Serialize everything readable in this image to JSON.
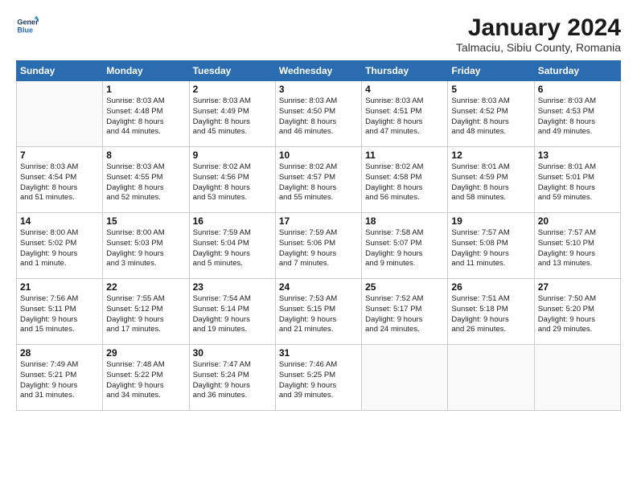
{
  "logo": {
    "line1": "General",
    "line2": "Blue"
  },
  "title": "January 2024",
  "subtitle": "Talmaciu, Sibiu County, Romania",
  "header_days": [
    "Sunday",
    "Monday",
    "Tuesday",
    "Wednesday",
    "Thursday",
    "Friday",
    "Saturday"
  ],
  "weeks": [
    [
      {
        "day": "",
        "text": ""
      },
      {
        "day": "1",
        "text": "Sunrise: 8:03 AM\nSunset: 4:48 PM\nDaylight: 8 hours\nand 44 minutes."
      },
      {
        "day": "2",
        "text": "Sunrise: 8:03 AM\nSunset: 4:49 PM\nDaylight: 8 hours\nand 45 minutes."
      },
      {
        "day": "3",
        "text": "Sunrise: 8:03 AM\nSunset: 4:50 PM\nDaylight: 8 hours\nand 46 minutes."
      },
      {
        "day": "4",
        "text": "Sunrise: 8:03 AM\nSunset: 4:51 PM\nDaylight: 8 hours\nand 47 minutes."
      },
      {
        "day": "5",
        "text": "Sunrise: 8:03 AM\nSunset: 4:52 PM\nDaylight: 8 hours\nand 48 minutes."
      },
      {
        "day": "6",
        "text": "Sunrise: 8:03 AM\nSunset: 4:53 PM\nDaylight: 8 hours\nand 49 minutes."
      }
    ],
    [
      {
        "day": "7",
        "text": "Sunrise: 8:03 AM\nSunset: 4:54 PM\nDaylight: 8 hours\nand 51 minutes."
      },
      {
        "day": "8",
        "text": "Sunrise: 8:03 AM\nSunset: 4:55 PM\nDaylight: 8 hours\nand 52 minutes."
      },
      {
        "day": "9",
        "text": "Sunrise: 8:02 AM\nSunset: 4:56 PM\nDaylight: 8 hours\nand 53 minutes."
      },
      {
        "day": "10",
        "text": "Sunrise: 8:02 AM\nSunset: 4:57 PM\nDaylight: 8 hours\nand 55 minutes."
      },
      {
        "day": "11",
        "text": "Sunrise: 8:02 AM\nSunset: 4:58 PM\nDaylight: 8 hours\nand 56 minutes."
      },
      {
        "day": "12",
        "text": "Sunrise: 8:01 AM\nSunset: 4:59 PM\nDaylight: 8 hours\nand 58 minutes."
      },
      {
        "day": "13",
        "text": "Sunrise: 8:01 AM\nSunset: 5:01 PM\nDaylight: 8 hours\nand 59 minutes."
      }
    ],
    [
      {
        "day": "14",
        "text": "Sunrise: 8:00 AM\nSunset: 5:02 PM\nDaylight: 9 hours\nand 1 minute."
      },
      {
        "day": "15",
        "text": "Sunrise: 8:00 AM\nSunset: 5:03 PM\nDaylight: 9 hours\nand 3 minutes."
      },
      {
        "day": "16",
        "text": "Sunrise: 7:59 AM\nSunset: 5:04 PM\nDaylight: 9 hours\nand 5 minutes."
      },
      {
        "day": "17",
        "text": "Sunrise: 7:59 AM\nSunset: 5:06 PM\nDaylight: 9 hours\nand 7 minutes."
      },
      {
        "day": "18",
        "text": "Sunrise: 7:58 AM\nSunset: 5:07 PM\nDaylight: 9 hours\nand 9 minutes."
      },
      {
        "day": "19",
        "text": "Sunrise: 7:57 AM\nSunset: 5:08 PM\nDaylight: 9 hours\nand 11 minutes."
      },
      {
        "day": "20",
        "text": "Sunrise: 7:57 AM\nSunset: 5:10 PM\nDaylight: 9 hours\nand 13 minutes."
      }
    ],
    [
      {
        "day": "21",
        "text": "Sunrise: 7:56 AM\nSunset: 5:11 PM\nDaylight: 9 hours\nand 15 minutes."
      },
      {
        "day": "22",
        "text": "Sunrise: 7:55 AM\nSunset: 5:12 PM\nDaylight: 9 hours\nand 17 minutes."
      },
      {
        "day": "23",
        "text": "Sunrise: 7:54 AM\nSunset: 5:14 PM\nDaylight: 9 hours\nand 19 minutes."
      },
      {
        "day": "24",
        "text": "Sunrise: 7:53 AM\nSunset: 5:15 PM\nDaylight: 9 hours\nand 21 minutes."
      },
      {
        "day": "25",
        "text": "Sunrise: 7:52 AM\nSunset: 5:17 PM\nDaylight: 9 hours\nand 24 minutes."
      },
      {
        "day": "26",
        "text": "Sunrise: 7:51 AM\nSunset: 5:18 PM\nDaylight: 9 hours\nand 26 minutes."
      },
      {
        "day": "27",
        "text": "Sunrise: 7:50 AM\nSunset: 5:20 PM\nDaylight: 9 hours\nand 29 minutes."
      }
    ],
    [
      {
        "day": "28",
        "text": "Sunrise: 7:49 AM\nSunset: 5:21 PM\nDaylight: 9 hours\nand 31 minutes."
      },
      {
        "day": "29",
        "text": "Sunrise: 7:48 AM\nSunset: 5:22 PM\nDaylight: 9 hours\nand 34 minutes."
      },
      {
        "day": "30",
        "text": "Sunrise: 7:47 AM\nSunset: 5:24 PM\nDaylight: 9 hours\nand 36 minutes."
      },
      {
        "day": "31",
        "text": "Sunrise: 7:46 AM\nSunset: 5:25 PM\nDaylight: 9 hours\nand 39 minutes."
      },
      {
        "day": "",
        "text": ""
      },
      {
        "day": "",
        "text": ""
      },
      {
        "day": "",
        "text": ""
      }
    ]
  ],
  "accent_color": "#2b6cb0"
}
